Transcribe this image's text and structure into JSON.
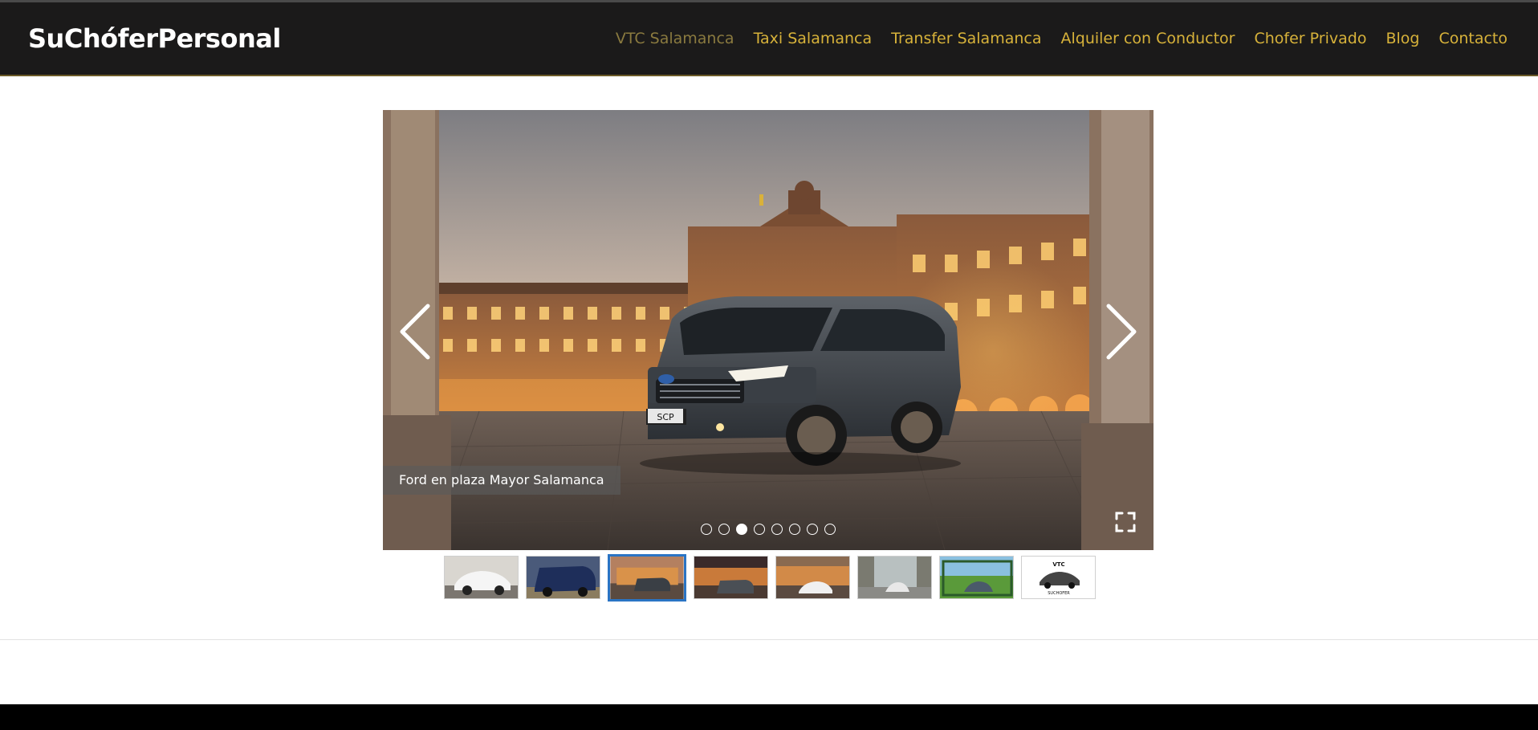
{
  "header": {
    "logo": "SuChóferPersonal",
    "nav": [
      {
        "label": "VTC Salamanca",
        "active": true
      },
      {
        "label": "Taxi Salamanca"
      },
      {
        "label": "Transfer Salamanca"
      },
      {
        "label": "Alquiler con Conductor"
      },
      {
        "label": "Chofer Privado"
      },
      {
        "label": "Blog"
      },
      {
        "label": "Contacto"
      }
    ]
  },
  "gallery": {
    "caption": "Ford en plaza Mayor Salamanca",
    "plate": "SCP",
    "slide_count": 8,
    "active_slide": 3,
    "thumbnails": [
      {
        "name": "white-sedan"
      },
      {
        "name": "blue-van"
      },
      {
        "name": "van-plaza-mayor",
        "active": true
      },
      {
        "name": "van-plaza-night"
      },
      {
        "name": "white-car-plaza"
      },
      {
        "name": "car-street"
      },
      {
        "name": "car-green-field"
      },
      {
        "name": "vtc-logo",
        "logo_top": "VTC",
        "logo_bottom": "SUCHOFER"
      }
    ]
  },
  "colors": {
    "header_bg": "#1b1a1a",
    "nav_link": "#d7b23a",
    "nav_active": "#8a7a3f",
    "thumb_active_border": "#2a74c4"
  }
}
